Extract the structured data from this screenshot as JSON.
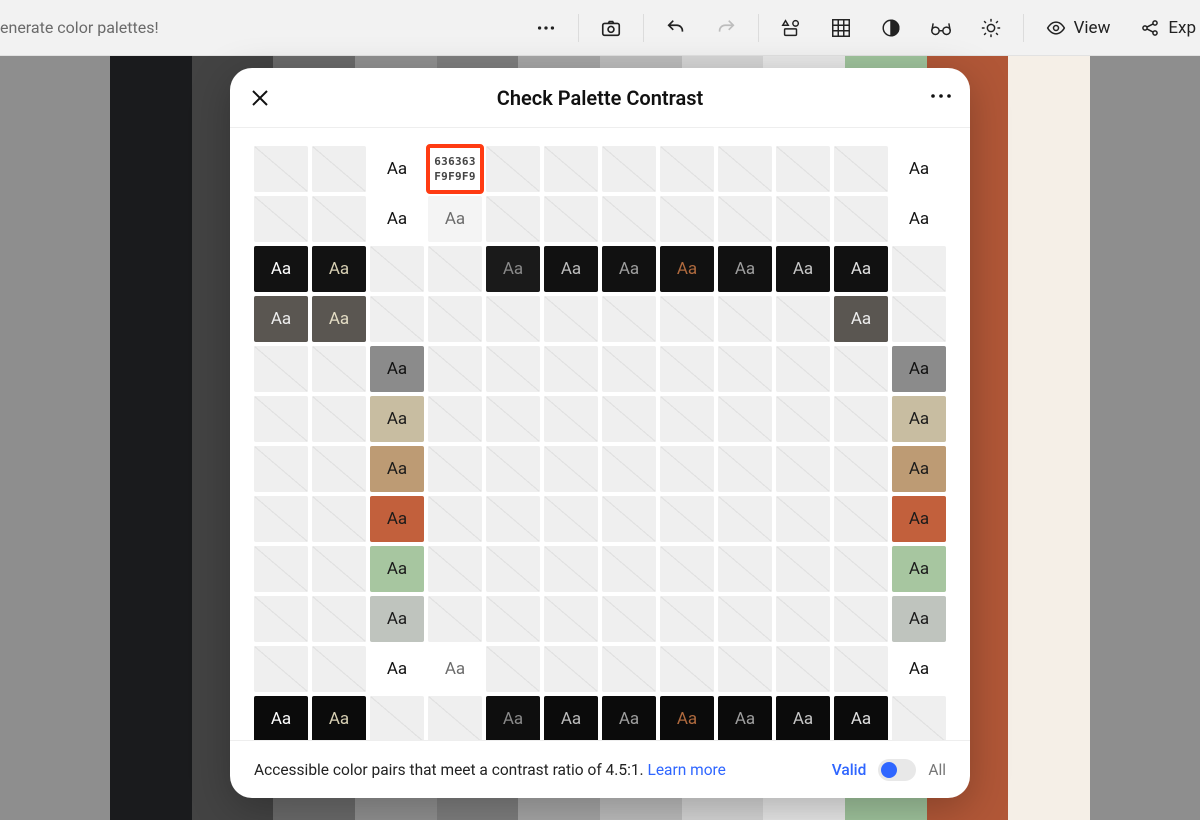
{
  "topbar": {
    "left_text": "enerate color palettes!",
    "view_label": "View",
    "export_label": "Exp"
  },
  "palette": [
    "#1a1b1d",
    "#434343",
    "#6a6a6a",
    "#909090",
    "#7e7e7e",
    "#a6a6a6",
    "#bdbdbd",
    "#d6d6d6",
    "#e8e8e8",
    "#9fc39c",
    "#b15737",
    "#f5efe7"
  ],
  "modal": {
    "title": "Check Palette Contrast",
    "aa": "Aa",
    "highlight": {
      "fg": "636363",
      "bg": "F9F9F9"
    },
    "footer": {
      "text_prefix": "Accessible color pairs that meet a contrast ratio of 4.5:1. ",
      "link": "Learn more",
      "valid": "Valid",
      "all": "All"
    },
    "grid": [
      [
        null,
        null,
        {
          "bg": "#ffffff",
          "fg": "#111"
        },
        "HL",
        null,
        null,
        null,
        null,
        null,
        null,
        null,
        {
          "bg": "#ffffff",
          "fg": "#111"
        }
      ],
      [
        null,
        null,
        {
          "bg": "#ffffff",
          "fg": "#111"
        },
        {
          "bg": "#f4f4f4",
          "fg": "#6b6b6b"
        },
        null,
        null,
        null,
        null,
        null,
        null,
        null,
        {
          "bg": "#ffffff",
          "fg": "#111"
        }
      ],
      [
        {
          "bg": "#121212",
          "fg": "#ffffff"
        },
        {
          "bg": "#121212",
          "fg": "#d8d0b4"
        },
        null,
        null,
        {
          "bg": "#1a1a1a",
          "fg": "#8a8a8a"
        },
        {
          "bg": "#111",
          "fg": "#bdbdbd"
        },
        {
          "bg": "#111",
          "fg": "#9f9f9f"
        },
        {
          "bg": "#111",
          "fg": "#b06a3e"
        },
        {
          "bg": "#111",
          "fg": "#9f9f9f"
        },
        {
          "bg": "#111",
          "fg": "#c7c7c7"
        },
        {
          "bg": "#111",
          "fg": "#e0e0e0"
        },
        null
      ],
      [
        {
          "bg": "#5a5651",
          "fg": "#eeeeee"
        },
        {
          "bg": "#5a5651",
          "fg": "#e4ddc5"
        },
        null,
        null,
        null,
        null,
        null,
        null,
        null,
        null,
        {
          "bg": "#5a5651",
          "fg": "#eeeeee"
        },
        null
      ],
      [
        null,
        null,
        {
          "bg": "#8b8b8b",
          "fg": "#111"
        },
        null,
        null,
        null,
        null,
        null,
        null,
        null,
        null,
        {
          "bg": "#8b8b8b",
          "fg": "#111"
        }
      ],
      [
        null,
        null,
        {
          "bg": "#c8bda1",
          "fg": "#1a1a1a"
        },
        null,
        null,
        null,
        null,
        null,
        null,
        null,
        null,
        {
          "bg": "#c8bda1",
          "fg": "#1a1a1a"
        }
      ],
      [
        null,
        null,
        {
          "bg": "#bd9b74",
          "fg": "#1a1a1a"
        },
        null,
        null,
        null,
        null,
        null,
        null,
        null,
        null,
        {
          "bg": "#bd9b74",
          "fg": "#1a1a1a"
        }
      ],
      [
        null,
        null,
        {
          "bg": "#c2603c",
          "fg": "#1a1a1a"
        },
        null,
        null,
        null,
        null,
        null,
        null,
        null,
        null,
        {
          "bg": "#c2603c",
          "fg": "#1a1a1a"
        }
      ],
      [
        null,
        null,
        {
          "bg": "#a7c6a0",
          "fg": "#1a1a1a"
        },
        null,
        null,
        null,
        null,
        null,
        null,
        null,
        null,
        {
          "bg": "#a7c6a0",
          "fg": "#1a1a1a"
        }
      ],
      [
        null,
        null,
        {
          "bg": "#bfc4be",
          "fg": "#1a1a1a"
        },
        null,
        null,
        null,
        null,
        null,
        null,
        null,
        null,
        {
          "bg": "#bfc4be",
          "fg": "#1a1a1a"
        }
      ],
      [
        null,
        null,
        {
          "bg": "#ffffff",
          "fg": "#111"
        },
        {
          "bg": "#ffffff",
          "fg": "#6b6b6b"
        },
        null,
        null,
        null,
        null,
        null,
        null,
        null,
        {
          "bg": "#ffffff",
          "fg": "#111"
        }
      ],
      [
        {
          "bg": "#0b0b0b",
          "fg": "#ffffff"
        },
        {
          "bg": "#0b0b0b",
          "fg": "#d8d0b4"
        },
        null,
        null,
        {
          "bg": "#0e0e0e",
          "fg": "#8a8a8a"
        },
        {
          "bg": "#0b0b0b",
          "fg": "#bdbdbd"
        },
        {
          "bg": "#0b0b0b",
          "fg": "#9f9f9f"
        },
        {
          "bg": "#0b0b0b",
          "fg": "#b06a3e"
        },
        {
          "bg": "#0b0b0b",
          "fg": "#9f9f9f"
        },
        {
          "bg": "#0b0b0b",
          "fg": "#c7c7c7"
        },
        {
          "bg": "#0b0b0b",
          "fg": "#e0e0e0"
        },
        null
      ]
    ]
  }
}
